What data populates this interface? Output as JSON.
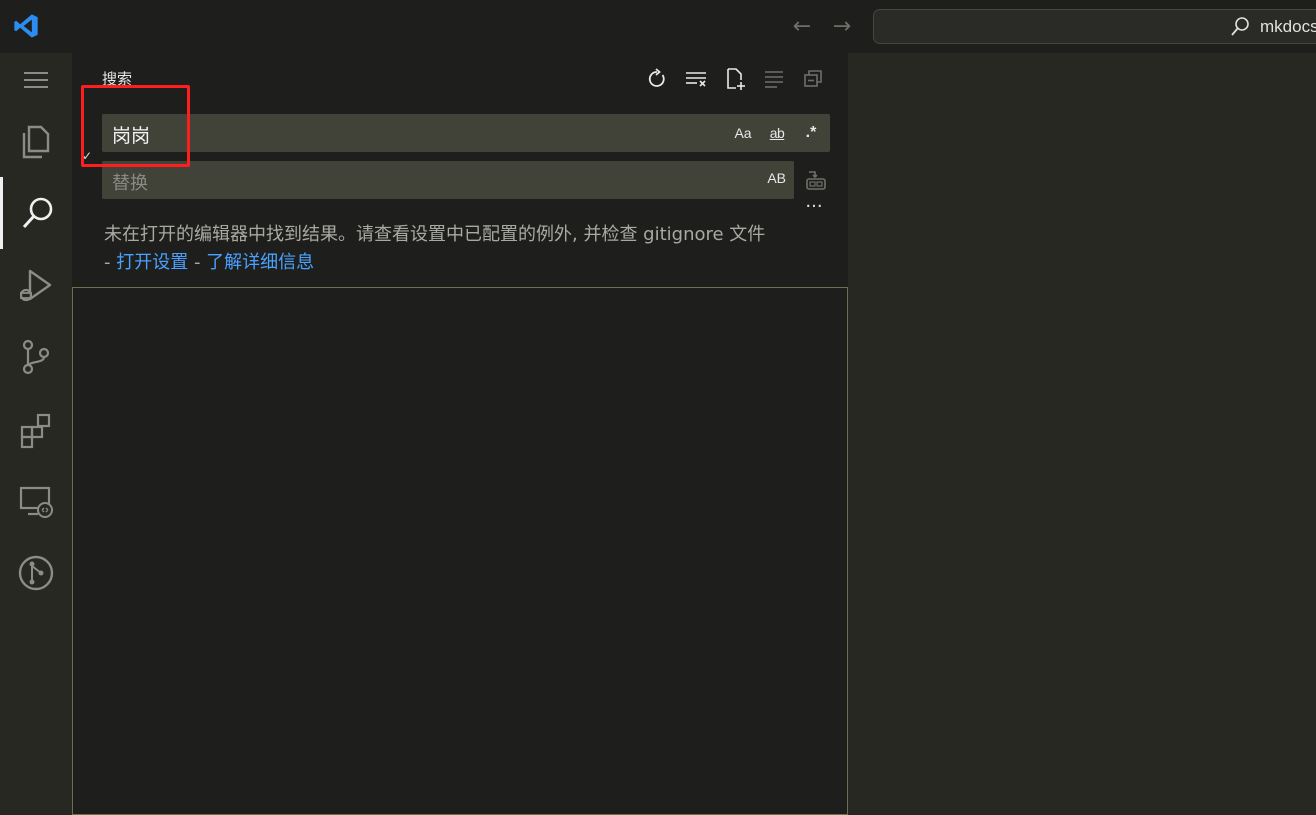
{
  "titlebar": {
    "logo": "vscode-logo-icon",
    "back_icon": "←",
    "forward_icon": "→",
    "command_center_text": "mkdocs"
  },
  "activitybar": {
    "items": [
      {
        "name": "menu",
        "icon": "hamburger-icon"
      },
      {
        "name": "explorer",
        "icon": "files-icon"
      },
      {
        "name": "search",
        "icon": "search-icon",
        "active": true
      },
      {
        "name": "run-debug",
        "icon": "run-debug-icon"
      },
      {
        "name": "source-control",
        "icon": "source-control-icon"
      },
      {
        "name": "extensions",
        "icon": "extensions-icon"
      },
      {
        "name": "remote-explorer",
        "icon": "remote-explorer-icon"
      },
      {
        "name": "git-graph",
        "icon": "git-graph-icon"
      }
    ]
  },
  "sidebar": {
    "title": "搜索",
    "actions": [
      "refresh-icon",
      "clear-results-icon",
      "new-search-editor-icon",
      "view-as-tree-icon",
      "collapse-all-icon"
    ],
    "toggle_replace": "✓",
    "search": {
      "value": "岗岗",
      "options": {
        "match_case": "Aa",
        "whole_word": "ab",
        "regex": ".*"
      }
    },
    "replace": {
      "placeholder": "替换",
      "preserve_case": "AB"
    },
    "more": "···",
    "message": {
      "text": "未在打开的编辑器中找到结果。请查看设置中已配置的例外, 并检查 gitignore 文件",
      "sep1": "- ",
      "link_open_settings": "打开设置",
      "sep2": " - ",
      "link_learn_more": "了解详细信息"
    }
  },
  "colors": {
    "accent_link": "#4aa0ff",
    "highlight": "#ff1e1e",
    "vscode_blue": "#2d8cf0"
  }
}
